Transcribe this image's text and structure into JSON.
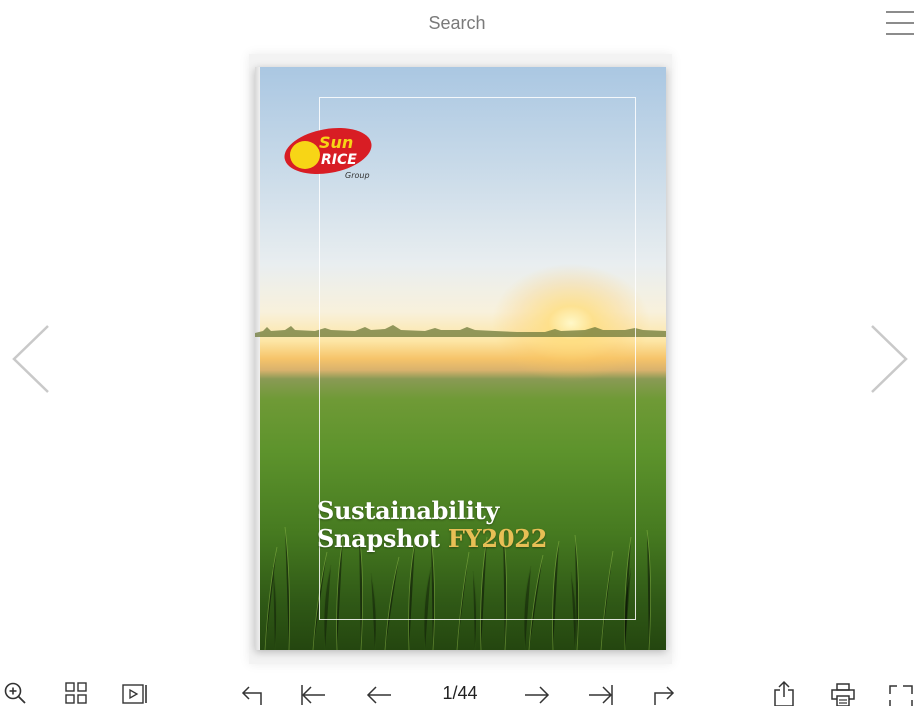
{
  "header": {
    "search_placeholder": "Search",
    "menu_icon": "hamburger-menu-icon"
  },
  "navigation": {
    "prev_icon": "chevron-left-icon",
    "next_icon": "chevron-right-icon"
  },
  "cover": {
    "logo": "SunRice Group",
    "title_line1": "Sustainability",
    "title_line2_word": "Snapshot",
    "title_line2_year": "FY2022",
    "colors": {
      "title": "#ffffff",
      "year_accent": "#e8bf55",
      "logo_red": "#d81d24",
      "logo_yellow": "#f7d516"
    }
  },
  "toolbar": {
    "current_page": "1",
    "separator": "/",
    "total_pages": "44",
    "icons": [
      "zoom-in-icon",
      "thumbnails-icon",
      "autoplay-icon",
      "back-icon",
      "first-page-icon",
      "previous-page-icon",
      "next-page-icon",
      "last-page-icon",
      "forward-icon",
      "share-icon",
      "print-icon",
      "fullscreen-icon"
    ]
  }
}
